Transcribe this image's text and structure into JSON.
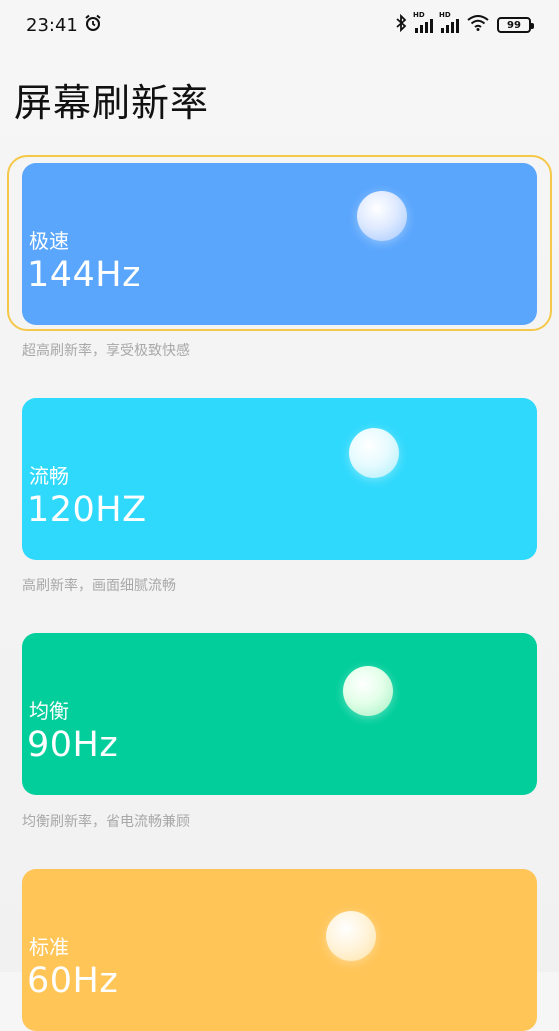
{
  "status_bar": {
    "time": "23:41",
    "alarm_icon": "alarm-icon",
    "bluetooth_icon": "bluetooth-icon",
    "signal_label": "HD",
    "wifi_icon": "wifi-icon",
    "battery": "99"
  },
  "page": {
    "title": "屏幕刷新率"
  },
  "options": [
    {
      "name": "极速",
      "rate": "144Hz",
      "description": "超高刷新率，享受极致快感",
      "color": "#5aa6fd",
      "selected": true
    },
    {
      "name": "流畅",
      "rate": "120HZ",
      "description": "高刷新率，画面细腻流畅",
      "color": "#2fd9fc",
      "selected": false
    },
    {
      "name": "均衡",
      "rate": "90Hz",
      "description": "均衡刷新率，省电流畅兼顾",
      "color": "#01ce9b",
      "selected": false
    },
    {
      "name": "标准",
      "rate": "60Hz",
      "description": "",
      "color": "#ffc557",
      "selected": false
    }
  ],
  "colors": {
    "selection_ring": "#f5c84a",
    "description_text": "#a8a8a8"
  }
}
